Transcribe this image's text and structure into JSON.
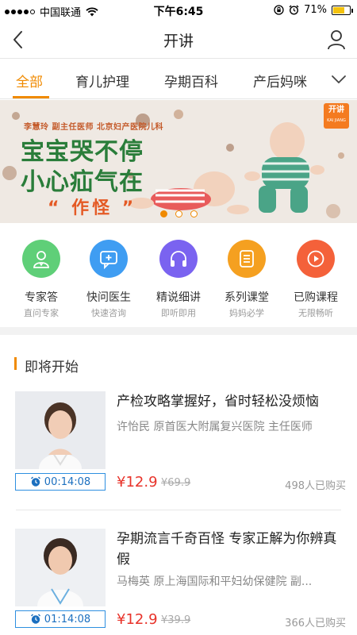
{
  "status_bar": {
    "carrier": "中国联通",
    "time": "下午6:45",
    "battery": "71%",
    "battery_level": 0.71,
    "icons": [
      "signal-icon",
      "wifi-icon",
      "lock-rotation-icon",
      "alarm-icon",
      "battery-icon"
    ]
  },
  "nav": {
    "title": "开讲",
    "back_icon": "chevron-left-icon",
    "user_icon": "user-icon"
  },
  "tabs": {
    "items": [
      {
        "label": "全部",
        "active": true
      },
      {
        "label": "育儿护理",
        "active": false
      },
      {
        "label": "孕期百科",
        "active": false
      },
      {
        "label": "产后妈咪",
        "active": false
      }
    ],
    "more_icon": "chevron-down-icon"
  },
  "banner": {
    "subtitle": "李慧玲  副主任医师  北京妇产医院儿科",
    "line1": "宝宝哭不停",
    "line2": "小心疝气在",
    "line3": "“ 作怪 ”",
    "badge_main": "开讲",
    "badge_sub": "KAI JIANG",
    "slide_count": 3,
    "active_slide": 1
  },
  "quick_entries": [
    {
      "label": "专家答",
      "sub": "直问专家",
      "icon": "doctor-icon",
      "color": "#5fcf78"
    },
    {
      "label": "快问医生",
      "sub": "快速咨询",
      "icon": "chat-plus-icon",
      "color": "#3f9df2"
    },
    {
      "label": "精说细讲",
      "sub": "即听即用",
      "icon": "headphones-icon",
      "color": "#7a63f0"
    },
    {
      "label": "系列课堂",
      "sub": "妈妈必学",
      "icon": "list-icon",
      "color": "#f5a020"
    },
    {
      "label": "已购课程",
      "sub": "无限畅听",
      "icon": "play-icon",
      "color": "#f4613a"
    }
  ],
  "section": {
    "title": "即将开始"
  },
  "courses": [
    {
      "title": "产检攻略掌握好，省时轻松没烦恼",
      "meta": "许怡民    原首医大附属复兴医院 主任医师",
      "timer": "00:14:08",
      "price": "¥12.9",
      "original_price": "¥69.9",
      "sold": "498人已购买"
    },
    {
      "title": "孕期流言千奇百怪 专家正解为你辨真假",
      "meta": "马梅英    原上海国际和平妇幼保健院 副...",
      "timer": "01:14:08",
      "price": "¥12.9",
      "original_price": "¥39.9",
      "sold": "366人已购买"
    }
  ]
}
